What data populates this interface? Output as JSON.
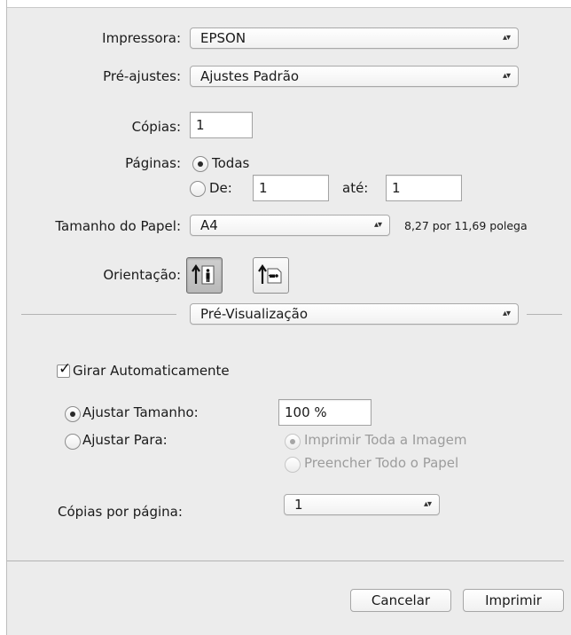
{
  "printer": {
    "label": "Impressora:",
    "value": "EPSON"
  },
  "presets": {
    "label": "Pré-ajustes:",
    "value": "Ajustes Padrão"
  },
  "copies": {
    "label": "Cópias:",
    "value": "1"
  },
  "pages": {
    "label": "Páginas:",
    "all_label": "Todas",
    "from_label": "De:",
    "from_value": "1",
    "to_label": "até:",
    "to_value": "1"
  },
  "paper_size": {
    "label": "Tamanho do Papel:",
    "value": "A4",
    "dimensions": "8,27 por 11,69 polega"
  },
  "orientation": {
    "label": "Orientação:"
  },
  "section": {
    "value": "Pré-Visualização"
  },
  "auto_rotate": {
    "label": "Girar Automaticamente",
    "checked": true
  },
  "scale": {
    "label": "Ajustar Tamanho:",
    "value": "100 %"
  },
  "fit": {
    "label": "Ajustar Para:",
    "print_entire_image": "Imprimir Toda a Imagem",
    "fill_entire_paper": "Preencher Todo o Papel"
  },
  "copies_per_page": {
    "label": "Cópias por página:",
    "value": "1"
  },
  "buttons": {
    "cancel": "Cancelar",
    "print": "Imprimir"
  },
  "icons": {
    "popup_arrows": "⌃⌄"
  }
}
